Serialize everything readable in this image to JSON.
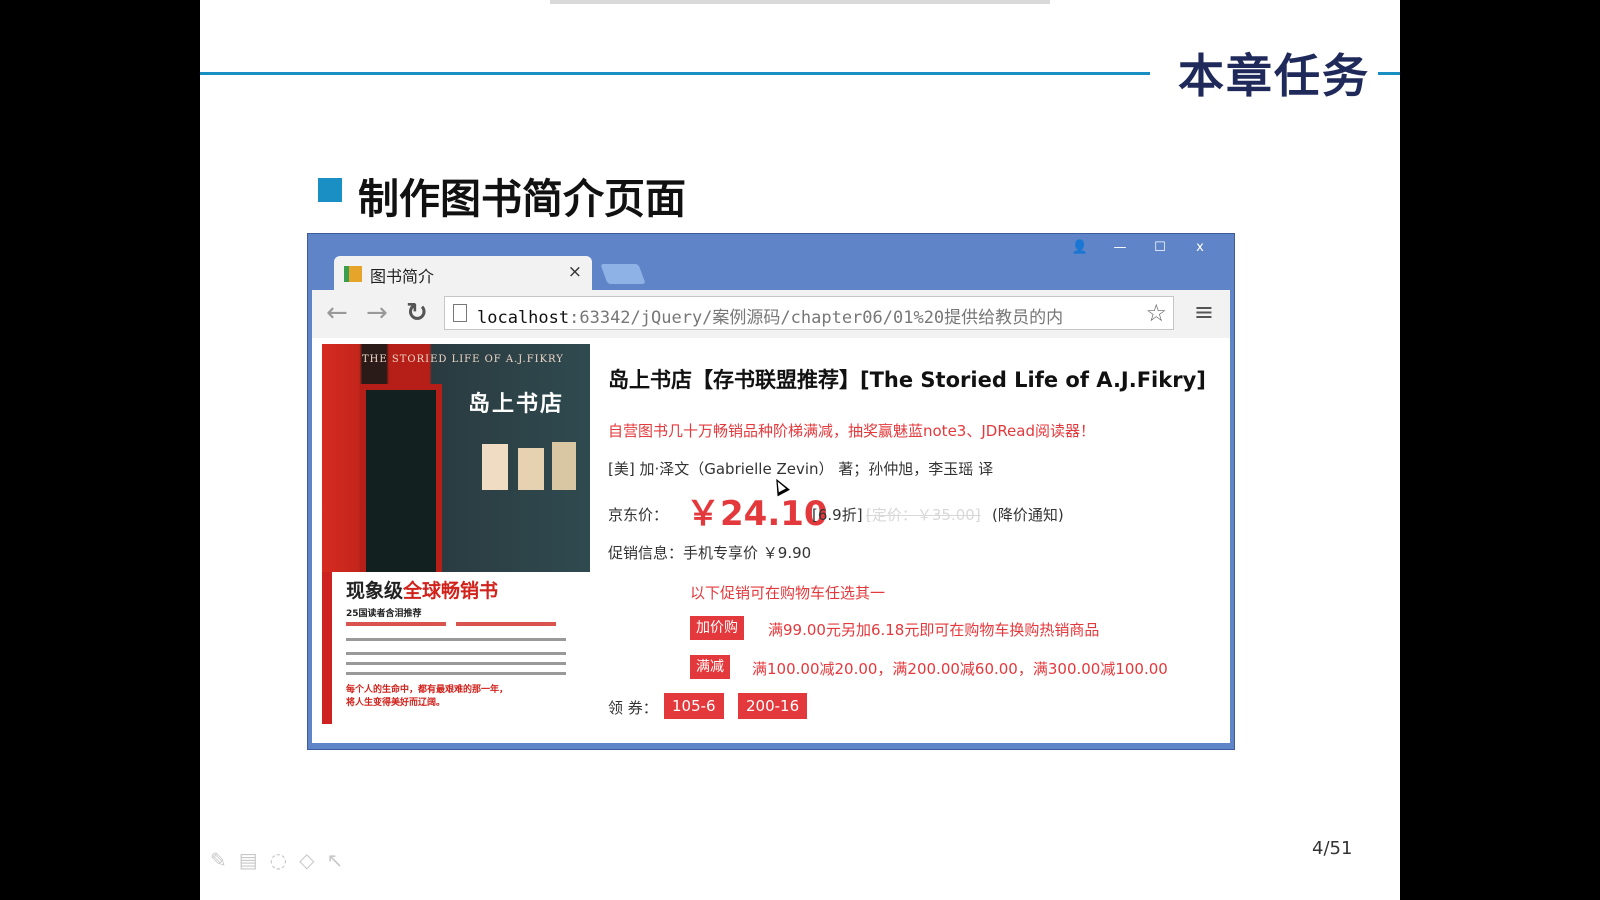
{
  "slide": {
    "chapter_title": "本章任务",
    "task_title": "制作图书简介页面",
    "page_number": "4/51"
  },
  "browser": {
    "tab_title": "图书简介",
    "tab_close": "×",
    "url_host": "localhost",
    "url_rest": ":63342/jQuery/案例源码/chapter06/01%20提供给教员的内",
    "controls": {
      "user": "👤",
      "minimize": "—",
      "maximize": "☐",
      "close": "x"
    },
    "icons": {
      "back": "back-arrow-icon",
      "forward": "forward-arrow-icon",
      "reload": "reload-icon",
      "star": "bookmark-star-icon",
      "menu": "menu-icon"
    }
  },
  "book_page": {
    "cover": {
      "english_title": "THE STORIED LIFE OF A.J.FIKRY",
      "chinese_title": "岛上书店",
      "headline_black": "现象级",
      "headline_red": "全球畅销书",
      "subline": "25国读者含泪推荐",
      "quote_line1": "每个人的生命中，都有最艰难的那一年，",
      "quote_line2": "将人生变得美好而辽阔。"
    },
    "title": "岛上书店【存书联盟推荐】[The Storied Life of A.J.Fikry]",
    "promo_line": "自营图书几十万畅销品种阶梯满减，抽奖赢魅蓝note3、JDRead阅读器！",
    "author_line": "[美] 加·泽文（Gabrielle Zevin） 著；孙仲旭，李玉瑶 译",
    "price_label": "京东价：",
    "price": "￥24.10",
    "discount": "[6.9折]",
    "list_price": "[定价：￥35.00]",
    "price_notify": "(降价通知)",
    "mobile_promo": "促销信息：手机专享价 ￥9.90",
    "promo_hint": "以下促销可在购物车任选其一",
    "addon_tag": "加价购",
    "addon_text": "满99.00元另加6.18元即可在购物车换购热销商品",
    "reduce_tag": "满减",
    "reduce_text": "满100.00减20.00，满200.00减60.00，满300.00减100.00",
    "coupon_label": "领 券：",
    "coupons": [
      "105-6",
      "200-16"
    ]
  },
  "colors": {
    "accent_blue": "#1a8fc4",
    "title_navy": "#1f2a5a",
    "price_red": "#e4393c",
    "window_frame": "#5f84c8"
  }
}
